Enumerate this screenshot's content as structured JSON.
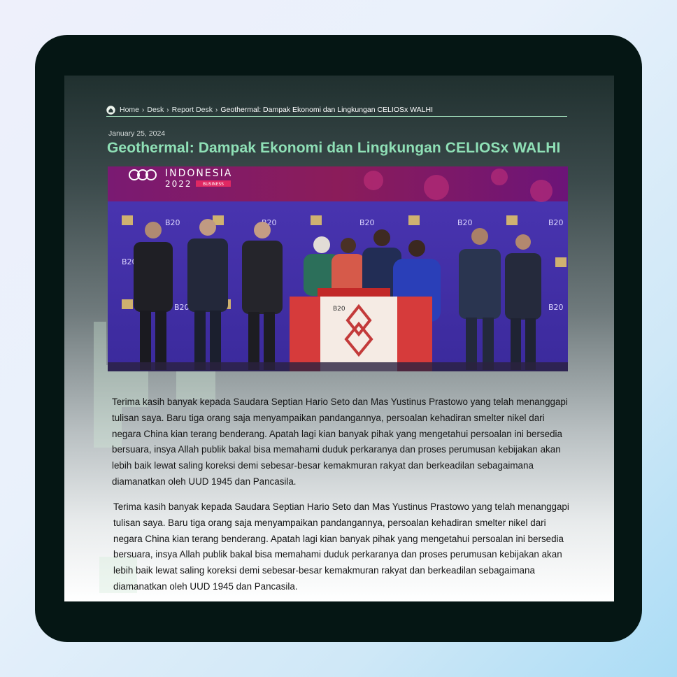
{
  "breadcrumb": {
    "items": [
      "Home",
      "Desk",
      "Report Desk"
    ],
    "current": "Geothermal: Dampak Ekonomi dan Lingkungan CELIOSx WALHI"
  },
  "article": {
    "date": "January 25, 2024",
    "title": "Geothermal: Dampak Ekonomi dan Lingkungan CELIOSx WALHI",
    "image": {
      "event_text_line1": "INDONESIA",
      "event_text_line2": "2022",
      "event_badge": "BUSINESS",
      "backdrop_label": "B20",
      "podium_label": "B20"
    },
    "paragraphs": [
      "Terima kasih banyak kepada Saudara Septian Hario Seto dan Mas Yustinus Prastowo yang telah menanggapi tulisan saya. Baru tiga orang saja menyampaikan pandangannya, persoalan kehadiran smelter nikel dari negara China kian terang benderang. Apatah lagi kian banyak pihak yang mengetahui persoalan ini bersedia bersuara, insya Allah publik bakal bisa memahami duduk perkaranya dan proses perumusan kebijakan akan lebih baik lewat saling koreksi demi sebesar-besar kemakmuran rakyat dan berkeadilan sebagaimana diamanatkan oleh UUD 1945 dan Pancasila.",
      "Terima kasih banyak kepada Saudara Septian Hario Seto dan Mas Yustinus Prastowo yang telah menanggapi tulisan saya. Baru tiga orang saja menyampaikan pandangannya, persoalan kehadiran smelter nikel dari negara China kian terang benderang. Apatah lagi kian banyak pihak yang mengetahui persoalan ini bersedia bersuara, insya Allah publik bakal bisa memahami duduk perkaranya dan proses perumusan kebijakan akan lebih baik lewat saling koreksi demi sebesar-besar kemakmuran rakyat dan berkeadilan sebagaimana diamanatkan oleh UUD 1945 dan Pancasila."
    ]
  },
  "colors": {
    "title": "#8fe0b6",
    "breadcrumb_rule": "#9bd6b4",
    "device_frame": "#051614",
    "backdrop_purple": "#4430a6"
  },
  "icons": [
    "home-icon",
    "chevron-right-icon"
  ]
}
